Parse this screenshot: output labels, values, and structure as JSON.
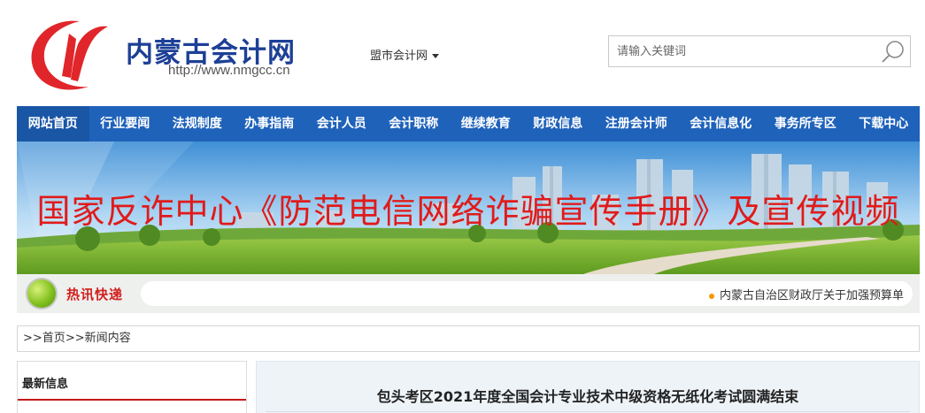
{
  "header": {
    "site_title": "内蒙古会计网",
    "site_url": "http://www.nmgcc.cn",
    "region_selector": "盟市会计网",
    "search_placeholder": "请输入关键词"
  },
  "nav": {
    "items": [
      "网站首页",
      "行业要闻",
      "法规制度",
      "办事指南",
      "会计人员",
      "会计职称",
      "继续教育",
      "财政信息",
      "注册会计师",
      "会计信息化",
      "事务所专区",
      "下载中心"
    ]
  },
  "banner": {
    "headline": "国家反诈中心《防范电信网络诈骗宣传手册》及宣传视频"
  },
  "hot_news": {
    "label": "热讯快递",
    "item": "内蒙古自治区财政厅关于加强预算单"
  },
  "breadcrumb": {
    "prefix": ">>",
    "home": "首页",
    "sep": ">>",
    "current": "新闻内容"
  },
  "sidebar": {
    "title": "最新信息"
  },
  "article": {
    "title": "包头考区2021年度全国会计专业技术中级资格无纸化考试圆满结束"
  },
  "colors": {
    "nav_bg": "#1f62ba",
    "brand_blue": "#1d3f96",
    "logo_red": "#e0262a",
    "banner_text": "#e01b1b",
    "accent_red": "#c41a1a"
  },
  "icons": {
    "logo": "nmgcc-logo-icon",
    "search": "search-icon",
    "dropdown": "caret-down-icon",
    "hot": "hot-news-ball-icon",
    "bullet": "dot-bullet-icon"
  }
}
